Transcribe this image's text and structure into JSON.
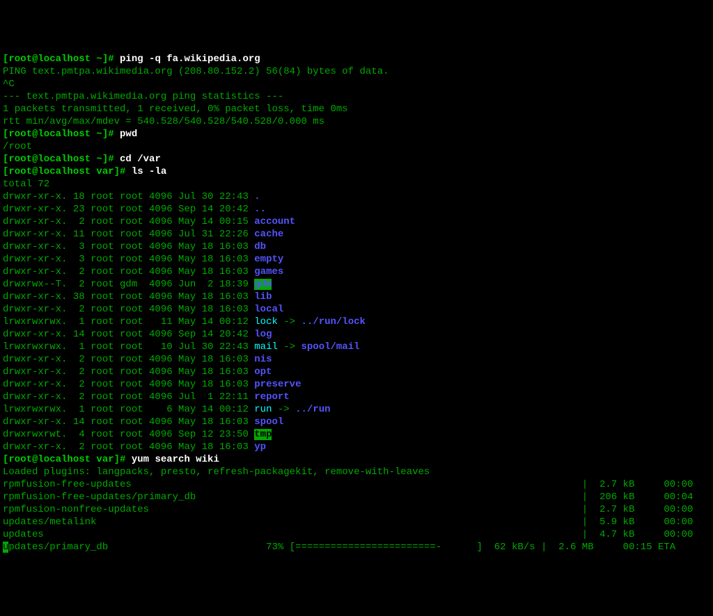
{
  "prompt_home": "[root@localhost ~]# ",
  "prompt_var": "[root@localhost var]# ",
  "ping_cmd": "ping -q fa.wikipedia.org",
  "ping_header": "PING text.pmtpa.wikimedia.org (208.80.152.2) 56(84) bytes of data.",
  "ping_interrupt": "^C",
  "ping_stats_hdr": "--- text.pmtpa.wikimedia.org ping statistics ---",
  "ping_stats_1": "1 packets transmitted, 1 received, 0% packet loss, time 0ms",
  "ping_stats_2": "rtt min/avg/max/mdev = 540.528/540.528/540.528/0.000 ms",
  "pwd_cmd": "pwd",
  "pwd_out": "/root",
  "cd_cmd": "cd /var",
  "ls_cmd": "ls -la",
  "ls_total": "total 72",
  "ls": [
    {
      "perm": "drwxr-xr-x.",
      "links": "18",
      "owner": "root",
      "group": "root",
      "size": "4096",
      "date": "Jul 30 22:43",
      "name": ".",
      "cls": "blue"
    },
    {
      "perm": "drwxr-xr-x.",
      "links": "23",
      "owner": "root",
      "group": "root",
      "size": "4096",
      "date": "Sep 14 20:42",
      "name": "..",
      "cls": "blue"
    },
    {
      "perm": "drwxr-xr-x.",
      "links": " 2",
      "owner": "root",
      "group": "root",
      "size": "4096",
      "date": "May 14 00:15",
      "name": "account",
      "cls": "blue"
    },
    {
      "perm": "drwxr-xr-x.",
      "links": "11",
      "owner": "root",
      "group": "root",
      "size": "4096",
      "date": "Jul 31 22:26",
      "name": "cache",
      "cls": "blue"
    },
    {
      "perm": "drwxr-xr-x.",
      "links": " 3",
      "owner": "root",
      "group": "root",
      "size": "4096",
      "date": "May 18 16:03",
      "name": "db",
      "cls": "blue"
    },
    {
      "perm": "drwxr-xr-x.",
      "links": " 3",
      "owner": "root",
      "group": "root",
      "size": "4096",
      "date": "May 18 16:03",
      "name": "empty",
      "cls": "blue"
    },
    {
      "perm": "drwxr-xr-x.",
      "links": " 2",
      "owner": "root",
      "group": "root",
      "size": "4096",
      "date": "May 18 16:03",
      "name": "games",
      "cls": "blue"
    },
    {
      "perm": "drwxrwx--T.",
      "links": " 2",
      "owner": "root",
      "group": "gdm ",
      "size": "4096",
      "date": "Jun  2 18:39",
      "name": "gdm",
      "cls": "hl"
    },
    {
      "perm": "drwxr-xr-x.",
      "links": "38",
      "owner": "root",
      "group": "root",
      "size": "4096",
      "date": "May 18 16:03",
      "name": "lib",
      "cls": "blue"
    },
    {
      "perm": "drwxr-xr-x.",
      "links": " 2",
      "owner": "root",
      "group": "root",
      "size": "4096",
      "date": "May 18 16:03",
      "name": "local",
      "cls": "blue"
    },
    {
      "perm": "lrwxrwxrwx.",
      "links": " 1",
      "owner": "root",
      "group": "root",
      "size": "  11",
      "date": "May 14 00:12",
      "name": "lock",
      "cls": "teal",
      "link": "../run/lock",
      "linkcls": "blue"
    },
    {
      "perm": "drwxr-xr-x.",
      "links": "14",
      "owner": "root",
      "group": "root",
      "size": "4096",
      "date": "Sep 14 20:42",
      "name": "log",
      "cls": "blue"
    },
    {
      "perm": "lrwxrwxrwx.",
      "links": " 1",
      "owner": "root",
      "group": "root",
      "size": "  10",
      "date": "Jul 30 22:43",
      "name": "mail",
      "cls": "teal",
      "link": "spool/mail",
      "linkcls": "blue"
    },
    {
      "perm": "drwxr-xr-x.",
      "links": " 2",
      "owner": "root",
      "group": "root",
      "size": "4096",
      "date": "May 18 16:03",
      "name": "nis",
      "cls": "blue"
    },
    {
      "perm": "drwxr-xr-x.",
      "links": " 2",
      "owner": "root",
      "group": "root",
      "size": "4096",
      "date": "May 18 16:03",
      "name": "opt",
      "cls": "blue"
    },
    {
      "perm": "drwxr-xr-x.",
      "links": " 2",
      "owner": "root",
      "group": "root",
      "size": "4096",
      "date": "May 18 16:03",
      "name": "preserve",
      "cls": "blue"
    },
    {
      "perm": "drwxr-xr-x.",
      "links": " 2",
      "owner": "root",
      "group": "root",
      "size": "4096",
      "date": "Jul  1 22:11",
      "name": "report",
      "cls": "blue"
    },
    {
      "perm": "lrwxrwxrwx.",
      "links": " 1",
      "owner": "root",
      "group": "root",
      "size": "   6",
      "date": "May 14 00:12",
      "name": "run",
      "cls": "teal",
      "link": "../run",
      "linkcls": "blue"
    },
    {
      "perm": "drwxr-xr-x.",
      "links": "14",
      "owner": "root",
      "group": "root",
      "size": "4096",
      "date": "May 18 16:03",
      "name": "spool",
      "cls": "blue"
    },
    {
      "perm": "drwxrwxrwt.",
      "links": " 4",
      "owner": "root",
      "group": "root",
      "size": "4096",
      "date": "Sep 12 23:50",
      "name": "tmp",
      "cls": "tmp"
    },
    {
      "perm": "drwxr-xr-x.",
      "links": " 2",
      "owner": "root",
      "group": "root",
      "size": "4096",
      "date": "May 18 16:03",
      "name": "yp",
      "cls": "blue"
    }
  ],
  "yum_cmd": "yum search wiki",
  "yum_plugins": "Loaded plugins: langpacks, presto, refresh-packagekit, remove-with-leaves",
  "downloads": [
    {
      "name": "rpmfusion-free-updates",
      "size": "2.7 kB",
      "time": "00:00"
    },
    {
      "name": "rpmfusion-free-updates/primary_db",
      "size": "206 kB",
      "time": "00:04"
    },
    {
      "name": "rpmfusion-nonfree-updates",
      "size": "2.7 kB",
      "time": "00:00"
    },
    {
      "name": "updates/metalink",
      "size": "5.9 kB",
      "time": "00:00"
    },
    {
      "name": "updates",
      "size": "4.7 kB",
      "time": "00:00"
    }
  ],
  "progress": {
    "cursor": "u",
    "name_rest": "pdates/primary_db",
    "pct": "73%",
    "bar": "[========================-      ]",
    "rate": " 62 kB/s",
    "size": "2.6 MB",
    "eta": "00:15 ETA"
  }
}
